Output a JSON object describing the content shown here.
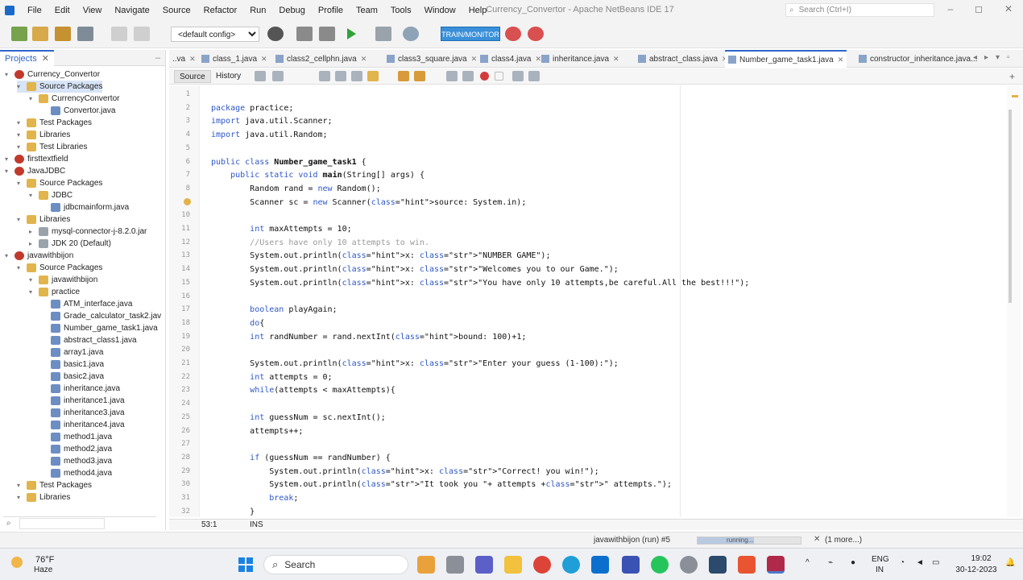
{
  "app": {
    "title": "Currency_Convertor - Apache NetBeans IDE 17",
    "search_placeholder": "Search (Ctrl+I)"
  },
  "menu": [
    "File",
    "Edit",
    "View",
    "Navigate",
    "Source",
    "Refactor",
    "Run",
    "Debug",
    "Profile",
    "Team",
    "Tools",
    "Window",
    "Help"
  ],
  "toolbar": {
    "config": "<default config>",
    "perf_label": "TRAIN/MONITOR"
  },
  "projects": {
    "tab_label": "Projects",
    "tree": [
      {
        "label": "Currency_Convertor",
        "depth": 0,
        "kind": "project"
      },
      {
        "label": "Source Packages",
        "depth": 1,
        "kind": "folder",
        "selected": true
      },
      {
        "label": "CurrencyConvertor",
        "depth": 2,
        "kind": "package"
      },
      {
        "label": "Convertor.java",
        "depth": 3,
        "kind": "java"
      },
      {
        "label": "Test Packages",
        "depth": 1,
        "kind": "folder"
      },
      {
        "label": "Libraries",
        "depth": 1,
        "kind": "folder"
      },
      {
        "label": "Test Libraries",
        "depth": 1,
        "kind": "folder"
      },
      {
        "label": "firsttextfield",
        "depth": 0,
        "kind": "project"
      },
      {
        "label": "JavaJDBC",
        "depth": 0,
        "kind": "project"
      },
      {
        "label": "Source Packages",
        "depth": 1,
        "kind": "folder"
      },
      {
        "label": "JDBC",
        "depth": 2,
        "kind": "package"
      },
      {
        "label": "jdbcmainform.java",
        "depth": 3,
        "kind": "java"
      },
      {
        "label": "Libraries",
        "depth": 1,
        "kind": "folder"
      },
      {
        "label": "mysql-connector-j-8.2.0.jar",
        "depth": 2,
        "kind": "jar"
      },
      {
        "label": "JDK 20 (Default)",
        "depth": 2,
        "kind": "jar"
      },
      {
        "label": "javawithbijon",
        "depth": 0,
        "kind": "project"
      },
      {
        "label": "Source Packages",
        "depth": 1,
        "kind": "folder"
      },
      {
        "label": "javawithbijon",
        "depth": 2,
        "kind": "package"
      },
      {
        "label": "practice",
        "depth": 2,
        "kind": "package"
      },
      {
        "label": "ATM_interface.java",
        "depth": 3,
        "kind": "java"
      },
      {
        "label": "Grade_calculator_task2.jav",
        "depth": 3,
        "kind": "java"
      },
      {
        "label": "Number_game_task1.java",
        "depth": 3,
        "kind": "java"
      },
      {
        "label": "abstract_class1.java",
        "depth": 3,
        "kind": "java"
      },
      {
        "label": "array1.java",
        "depth": 3,
        "kind": "java"
      },
      {
        "label": "basic1.java",
        "depth": 3,
        "kind": "java"
      },
      {
        "label": "basic2.java",
        "depth": 3,
        "kind": "java"
      },
      {
        "label": "inheritance.java",
        "depth": 3,
        "kind": "java"
      },
      {
        "label": "inheritance1.java",
        "depth": 3,
        "kind": "java"
      },
      {
        "label": "inheritance3.java",
        "depth": 3,
        "kind": "java"
      },
      {
        "label": "inheritance4.java",
        "depth": 3,
        "kind": "java"
      },
      {
        "label": "method1.java",
        "depth": 3,
        "kind": "java"
      },
      {
        "label": "method2.java",
        "depth": 3,
        "kind": "java"
      },
      {
        "label": "method3.java",
        "depth": 3,
        "kind": "java"
      },
      {
        "label": "method4.java",
        "depth": 3,
        "kind": "java"
      },
      {
        "label": "Test Packages",
        "depth": 1,
        "kind": "folder"
      },
      {
        "label": "Libraries",
        "depth": 1,
        "kind": "folder"
      }
    ]
  },
  "editor": {
    "tabs": [
      "..va",
      "class_1.java",
      "class2_cellphn.java",
      "class3_square.java",
      "class4.java",
      "inheritance.java",
      "abstract_class.java",
      "Number_game_task1.java",
      "constructor_inheritance.java..."
    ],
    "active_tab": 7,
    "source_label": "Source",
    "history_label": "History",
    "position": "53:1",
    "mode": "INS"
  },
  "code": [
    {
      "n": "1",
      "t": ""
    },
    {
      "n": "2",
      "t": "package practice;"
    },
    {
      "n": "3",
      "t": "import java.util.Scanner;"
    },
    {
      "n": "4",
      "t": "import java.util.Random;"
    },
    {
      "n": "5",
      "t": ""
    },
    {
      "n": "6",
      "t": "public class Number_game_task1 {"
    },
    {
      "n": "7",
      "t": "    public static void main(String[] args) {"
    },
    {
      "n": "8",
      "t": "        Random rand = new Random();"
    },
    {
      "n": "9",
      "t": "        Scanner sc = new Scanner(source: System.in);"
    },
    {
      "n": "10",
      "t": ""
    },
    {
      "n": "11",
      "t": "        int maxAttempts = 10;"
    },
    {
      "n": "12",
      "t": "        //Users have only 10 attempts to win."
    },
    {
      "n": "13",
      "t": "        System.out.println(x: \"NUMBER GAME\");"
    },
    {
      "n": "14",
      "t": "        System.out.println(x: \"Welcomes you to our Game.\");"
    },
    {
      "n": "15",
      "t": "        System.out.println(x: \"You have only 10 attempts,be careful.All the best!!!\");"
    },
    {
      "n": "16",
      "t": ""
    },
    {
      "n": "17",
      "t": "        boolean playAgain;"
    },
    {
      "n": "18",
      "t": "        do{"
    },
    {
      "n": "19",
      "t": "        int randNumber = rand.nextInt(bound: 100)+1;"
    },
    {
      "n": "20",
      "t": ""
    },
    {
      "n": "21",
      "t": "        System.out.println(x: \"Enter your guess (1-100):\");"
    },
    {
      "n": "22",
      "t": "        int attempts = 0;"
    },
    {
      "n": "23",
      "t": "        while(attempts < maxAttempts){"
    },
    {
      "n": "24",
      "t": ""
    },
    {
      "n": "25",
      "t": "        int guessNum = sc.nextInt();"
    },
    {
      "n": "26",
      "t": "        attempts++;"
    },
    {
      "n": "27",
      "t": ""
    },
    {
      "n": "28",
      "t": "        if (guessNum == randNumber) {"
    },
    {
      "n": "29",
      "t": "            System.out.println(x: \"Correct! you win!\");"
    },
    {
      "n": "30",
      "t": "            System.out.println(\"It took you \"+ attempts +\" attempts.\");"
    },
    {
      "n": "31",
      "t": "            break;"
    },
    {
      "n": "32",
      "t": "        }"
    }
  ],
  "status": {
    "task": "javawithbijon (run) #5",
    "progress_label": "running...",
    "more": "(1 more...)",
    "progress": 0.55
  },
  "taskbar": {
    "weather_temp": "76°F",
    "weather_desc": "Haze",
    "search_label": "Search",
    "lang_top": "ENG",
    "lang_bottom": "IN",
    "time": "19:02",
    "date": "30-12-2023"
  }
}
